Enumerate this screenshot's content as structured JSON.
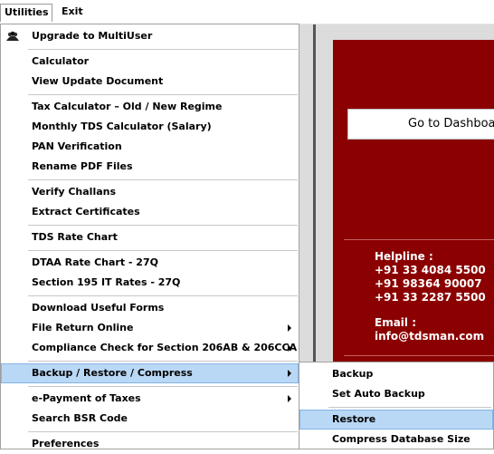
{
  "menubar": {
    "utilities": "Utilities",
    "exit": "Exit"
  },
  "menu": {
    "upgrade": "Upgrade to MultiUser",
    "calculator": "Calculator",
    "view_update": "View Update Document",
    "tax_calc": "Tax Calculator – Old / New Regime",
    "monthly_tds": "Monthly TDS Calculator (Salary)",
    "pan": "PAN Verification",
    "rename_pdf": "Rename PDF Files",
    "verify_challans": "Verify Challans",
    "extract_cert": "Extract Certificates",
    "tds_rate": "TDS Rate Chart",
    "dtaa": "DTAA Rate Chart - 27Q",
    "sec195": "Section 195 IT Rates - 27Q",
    "download_forms": "Download Useful Forms",
    "file_return": "File Return Online",
    "compliance": "Compliance Check for Section 206AB & 206CCA",
    "backup_restore": "Backup / Restore / Compress",
    "epayment": "e-Payment of Taxes",
    "search_bsr": "Search BSR Code",
    "preferences": "Preferences"
  },
  "submenu": {
    "backup": "Backup",
    "set_auto_backup": "Set Auto Backup",
    "restore": "Restore",
    "compress_db": "Compress Database Size"
  },
  "background": {
    "dashboard_button": "Go to Dashboard",
    "helpline_label": "Helpline :",
    "phone1": "+91 33 4084 5500",
    "phone2": "+91 98364 90007",
    "phone3": "+91 33 2287 5500",
    "email_label": "Email :",
    "email": "info@tdsman.com"
  },
  "colors": {
    "panel_red": "#8b0000",
    "highlight": "#b9d8f5"
  },
  "icons": {
    "upgrade": "users-icon",
    "submenu_arrow": "chevron-right-icon"
  }
}
